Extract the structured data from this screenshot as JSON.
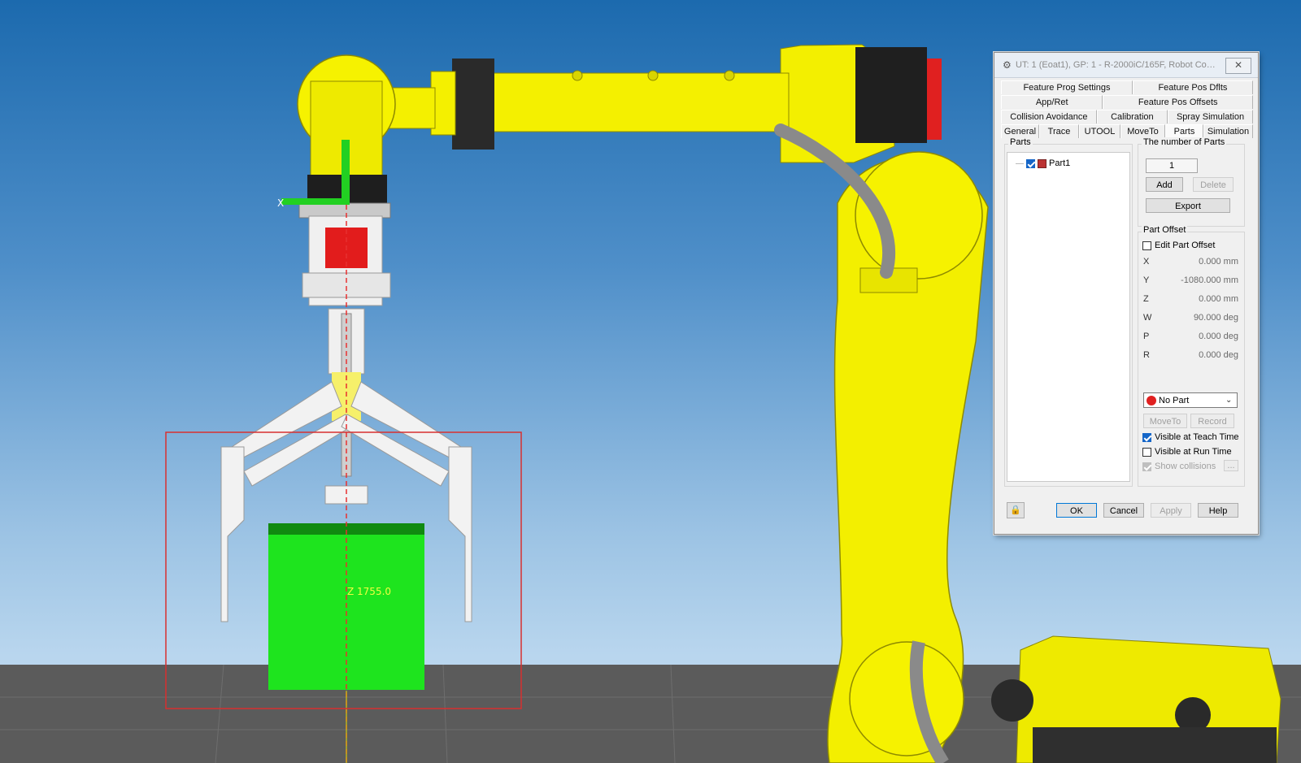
{
  "viewport": {
    "axis_label_x": "X",
    "dimension_label": "Z 1755.0",
    "colors": {
      "robot": "#f4f000",
      "floor": "#5a5a5a",
      "part": "#1ee41e",
      "bounding_box": "#d23030"
    }
  },
  "dialog": {
    "title": "UT: 1  (Eoat1), GP: 1 - R-2000iC/165F, Robot Contr...",
    "title_icon": "gear-icon",
    "close_icon": "close-icon",
    "tab_rows": [
      [
        "Feature Prog Settings",
        "Feature Pos Dflts"
      ],
      [
        "App/Ret",
        "Feature Pos Offsets"
      ],
      [
        "Collision Avoidance",
        "Calibration",
        "Spray Simulation"
      ],
      [
        "General",
        "Trace",
        "UTOOL",
        "MoveTo",
        "Parts",
        "Simulation"
      ]
    ],
    "active_tab": "Parts",
    "parts_group_label": "Parts",
    "tree_items": [
      {
        "label": "Part1",
        "checked": true
      }
    ],
    "number_group_label": "The number of Parts",
    "number_value": "1",
    "add_label": "Add",
    "delete_label": "Delete",
    "export_label": "Export",
    "offset_group_label": "Part Offset",
    "edit_offset_label": "Edit Part Offset",
    "edit_offset_checked": false,
    "offsets": [
      {
        "axis": "X",
        "value": "0.000 mm"
      },
      {
        "axis": "Y",
        "value": "-1080.000 mm"
      },
      {
        "axis": "Z",
        "value": "0.000 mm"
      },
      {
        "axis": "W",
        "value": "90.000 deg"
      },
      {
        "axis": "P",
        "value": "0.000 deg"
      },
      {
        "axis": "R",
        "value": "0.000 deg"
      }
    ],
    "part_select_value": "No Part",
    "moveto_label": "MoveTo",
    "record_label": "Record",
    "visible_teach_label": "Visible at Teach Time",
    "visible_teach_checked": true,
    "visible_run_label": "Visible at Run Time",
    "visible_run_checked": false,
    "show_collisions_label": "Show collisions",
    "show_collisions_checked": true,
    "more_label": "...",
    "lock_icon": "lock-icon",
    "ok_label": "OK",
    "cancel_label": "Cancel",
    "apply_label": "Apply",
    "help_label": "Help"
  }
}
